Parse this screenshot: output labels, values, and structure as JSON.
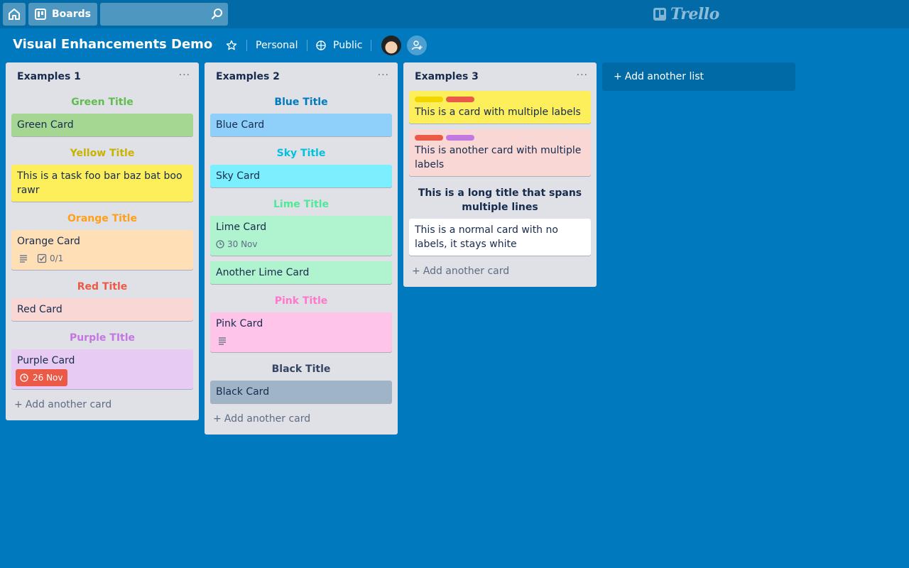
{
  "header": {
    "boards_label": "Boards",
    "search_value": "",
    "logo_text": "Trello"
  },
  "board": {
    "title": "Visual Enhancements Demo",
    "team": "Personal",
    "visibility": "Public"
  },
  "lists": [
    {
      "title": "Examples 1",
      "menu": "···",
      "add_card": "Add another card",
      "items": [
        {
          "kind": "title",
          "text": "Green Title",
          "color": "#61bd4f"
        },
        {
          "kind": "card",
          "text": "Green Card",
          "bg": "#a5d793"
        },
        {
          "kind": "title",
          "text": "Yellow Title",
          "color": "#c9b200"
        },
        {
          "kind": "card",
          "text": "This is a task foo bar baz bat boo rawr",
          "bg": "#fdee5c"
        },
        {
          "kind": "title",
          "text": "Orange Title",
          "color": "#ff9f1a"
        },
        {
          "kind": "card",
          "text": "Orange Card",
          "bg": "#ffdfb6",
          "checklist": "0/1",
          "description": true
        },
        {
          "kind": "title",
          "text": "Red Title",
          "color": "#eb5a46"
        },
        {
          "kind": "card",
          "text": "Red Card",
          "bg": "#f8d7d4"
        },
        {
          "kind": "title",
          "text": "Purple TItle",
          "color": "#c377e0"
        },
        {
          "kind": "card",
          "text": "Purple Card",
          "bg": "#e8cbf3",
          "due": "26 Nov",
          "due_overdue": true
        }
      ]
    },
    {
      "title": "Examples 2",
      "menu": "···",
      "add_card": "Add another card",
      "items": [
        {
          "kind": "title",
          "text": "Blue Title",
          "color": "#0079bf"
        },
        {
          "kind": "card",
          "text": "Blue Card",
          "bg": "#8ed0fa"
        },
        {
          "kind": "title",
          "text": "Sky Title",
          "color": "#00c2e0"
        },
        {
          "kind": "card",
          "text": "Sky Card",
          "bg": "#7ceffe"
        },
        {
          "kind": "title",
          "text": "Lime Title",
          "color": "#51e898"
        },
        {
          "kind": "card",
          "text": "Lime Card",
          "bg": "#aff4ce",
          "due": "30 Nov"
        },
        {
          "kind": "card",
          "text": "Another Lime Card",
          "bg": "#aff4ce"
        },
        {
          "kind": "title",
          "text": "Pink Title",
          "color": "#ff78cb"
        },
        {
          "kind": "card",
          "text": "Pink Card",
          "bg": "#ffc4e9",
          "description": true
        },
        {
          "kind": "title",
          "text": "Black Title",
          "color": "#344563"
        },
        {
          "kind": "card",
          "text": "Black Card",
          "bg": "#9fb5c7"
        }
      ]
    },
    {
      "title": "Examples 3",
      "menu": "···",
      "add_card": "Add another card",
      "items": [
        {
          "kind": "card",
          "text": "This is a card with multiple labels",
          "bg": "#fdee5c",
          "labels": [
            "#f2d600",
            "#eb5a46"
          ]
        },
        {
          "kind": "card",
          "text": "This is another card with multiple labels",
          "bg": "#f8d7d4",
          "labels": [
            "#eb5a46",
            "#c377e0"
          ]
        },
        {
          "kind": "title",
          "text": "This is a long title that spans multiple lines",
          "color": "#172b4d"
        },
        {
          "kind": "card",
          "text": "This is a normal card with no labels, it stays white",
          "bg": "#ffffff"
        }
      ]
    }
  ],
  "add_list_label": "Add another list"
}
